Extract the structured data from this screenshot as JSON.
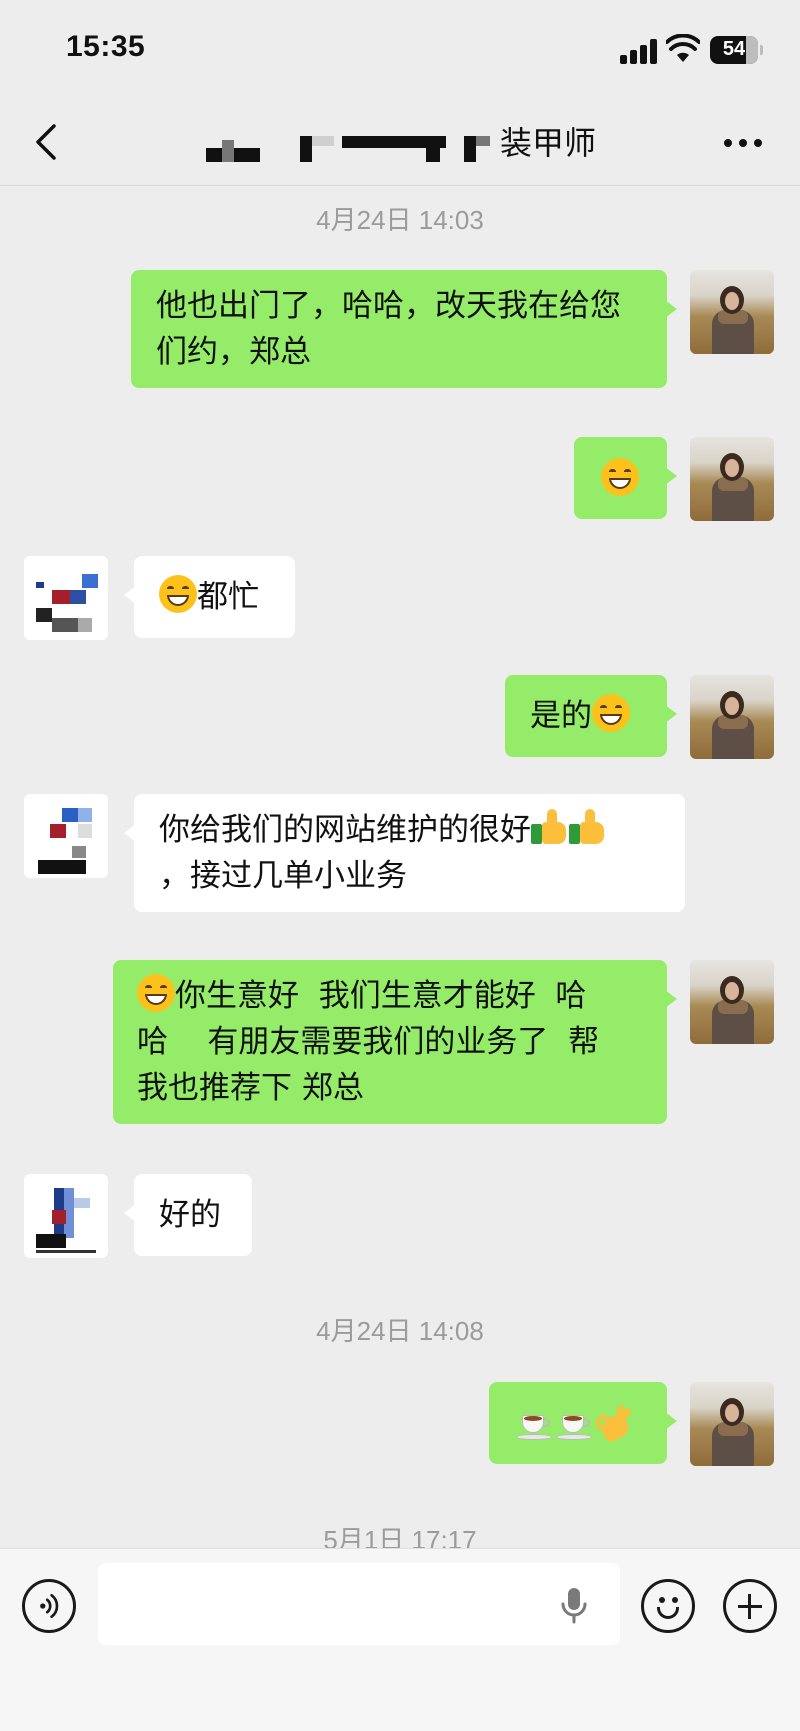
{
  "status_bar": {
    "time": "15:35",
    "battery": "54"
  },
  "nav": {
    "title_suffix": "装甲师"
  },
  "messages": [
    {
      "type": "timestamp",
      "text": "4月24日 14:03"
    },
    {
      "type": "outgoing",
      "text": "他也出门了，哈哈，改天我在给您们约，郑总"
    },
    {
      "type": "outgoing",
      "emoji": [
        "face-with-tears-of-joy"
      ]
    },
    {
      "type": "incoming",
      "text": "都忙",
      "emoji": [
        "grinning-face-with-smiling-eyes"
      ]
    },
    {
      "type": "outgoing",
      "text": "是的",
      "emoji": [
        "face-with-tears-of-joy"
      ]
    },
    {
      "type": "incoming",
      "line1": "你给我们的网站维护的很好",
      "line2": "，接过几单小业务",
      "emoji": [
        "thumbs-up",
        "thumbs-up"
      ]
    },
    {
      "type": "outgoing",
      "line1": "你生意好  我们生意才能好  哈",
      "line2": "哈    有朋友需要我们的业务了  帮",
      "line3": "我也推荐下 郑总",
      "emoji": [
        "beaming-face"
      ]
    },
    {
      "type": "incoming",
      "text": "好的"
    },
    {
      "type": "timestamp",
      "text": "4月24日 14:08"
    },
    {
      "type": "outgoing",
      "emoji": [
        "hot-beverage",
        "hot-beverage",
        "ok-hand"
      ]
    },
    {
      "type": "timestamp",
      "text": "5月1日 17:17"
    }
  ],
  "input": {
    "placeholder": ""
  },
  "colors": {
    "outgoing_bubble": "#95ec69",
    "incoming_bubble": "#ffffff",
    "background": "#ededed"
  }
}
